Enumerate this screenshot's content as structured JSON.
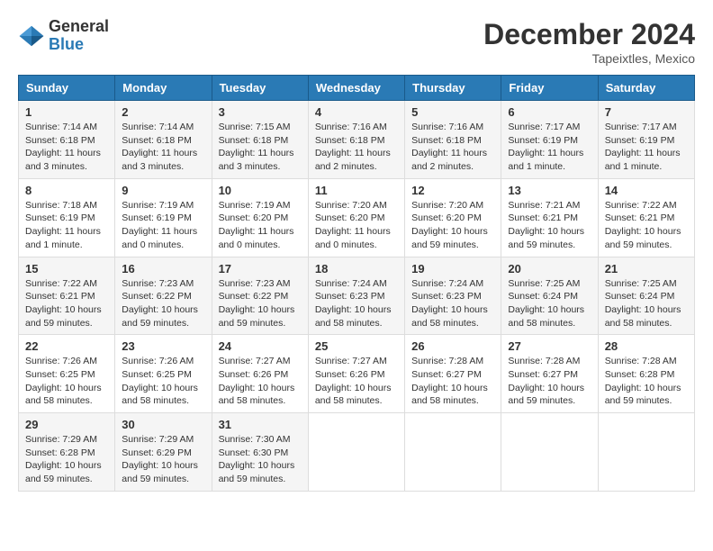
{
  "header": {
    "logo": {
      "general": "General",
      "blue": "Blue"
    },
    "title": "December 2024",
    "location": "Tapeixtles, Mexico"
  },
  "calendar": {
    "days_of_week": [
      "Sunday",
      "Monday",
      "Tuesday",
      "Wednesday",
      "Thursday",
      "Friday",
      "Saturday"
    ],
    "weeks": [
      [
        null,
        null,
        null,
        null,
        null,
        null,
        {
          "day": "1",
          "sunrise": "7:14 AM",
          "sunset": "6:18 PM",
          "daylight": "11 hours and 3 minutes."
        }
      ],
      [
        {
          "day": "1",
          "sunrise": "7:14 AM",
          "sunset": "6:18 PM",
          "daylight": "11 hours and 3 minutes."
        },
        {
          "day": "2",
          "sunrise": "7:14 AM",
          "sunset": "6:18 PM",
          "daylight": "11 hours and 3 minutes."
        },
        {
          "day": "3",
          "sunrise": "7:15 AM",
          "sunset": "6:18 PM",
          "daylight": "11 hours and 3 minutes."
        },
        {
          "day": "4",
          "sunrise": "7:16 AM",
          "sunset": "6:18 PM",
          "daylight": "11 hours and 2 minutes."
        },
        {
          "day": "5",
          "sunrise": "7:16 AM",
          "sunset": "6:18 PM",
          "daylight": "11 hours and 2 minutes."
        },
        {
          "day": "6",
          "sunrise": "7:17 AM",
          "sunset": "6:19 PM",
          "daylight": "11 hours and 1 minute."
        },
        {
          "day": "7",
          "sunrise": "7:17 AM",
          "sunset": "6:19 PM",
          "daylight": "11 hours and 1 minute."
        }
      ],
      [
        {
          "day": "8",
          "sunrise": "7:18 AM",
          "sunset": "6:19 PM",
          "daylight": "11 hours and 1 minute."
        },
        {
          "day": "9",
          "sunrise": "7:19 AM",
          "sunset": "6:19 PM",
          "daylight": "11 hours and 0 minutes."
        },
        {
          "day": "10",
          "sunrise": "7:19 AM",
          "sunset": "6:20 PM",
          "daylight": "11 hours and 0 minutes."
        },
        {
          "day": "11",
          "sunrise": "7:20 AM",
          "sunset": "6:20 PM",
          "daylight": "11 hours and 0 minutes."
        },
        {
          "day": "12",
          "sunrise": "7:20 AM",
          "sunset": "6:20 PM",
          "daylight": "10 hours and 59 minutes."
        },
        {
          "day": "13",
          "sunrise": "7:21 AM",
          "sunset": "6:21 PM",
          "daylight": "10 hours and 59 minutes."
        },
        {
          "day": "14",
          "sunrise": "7:22 AM",
          "sunset": "6:21 PM",
          "daylight": "10 hours and 59 minutes."
        }
      ],
      [
        {
          "day": "15",
          "sunrise": "7:22 AM",
          "sunset": "6:21 PM",
          "daylight": "10 hours and 59 minutes."
        },
        {
          "day": "16",
          "sunrise": "7:23 AM",
          "sunset": "6:22 PM",
          "daylight": "10 hours and 59 minutes."
        },
        {
          "day": "17",
          "sunrise": "7:23 AM",
          "sunset": "6:22 PM",
          "daylight": "10 hours and 59 minutes."
        },
        {
          "day": "18",
          "sunrise": "7:24 AM",
          "sunset": "6:23 PM",
          "daylight": "10 hours and 58 minutes."
        },
        {
          "day": "19",
          "sunrise": "7:24 AM",
          "sunset": "6:23 PM",
          "daylight": "10 hours and 58 minutes."
        },
        {
          "day": "20",
          "sunrise": "7:25 AM",
          "sunset": "6:24 PM",
          "daylight": "10 hours and 58 minutes."
        },
        {
          "day": "21",
          "sunrise": "7:25 AM",
          "sunset": "6:24 PM",
          "daylight": "10 hours and 58 minutes."
        }
      ],
      [
        {
          "day": "22",
          "sunrise": "7:26 AM",
          "sunset": "6:25 PM",
          "daylight": "10 hours and 58 minutes."
        },
        {
          "day": "23",
          "sunrise": "7:26 AM",
          "sunset": "6:25 PM",
          "daylight": "10 hours and 58 minutes."
        },
        {
          "day": "24",
          "sunrise": "7:27 AM",
          "sunset": "6:26 PM",
          "daylight": "10 hours and 58 minutes."
        },
        {
          "day": "25",
          "sunrise": "7:27 AM",
          "sunset": "6:26 PM",
          "daylight": "10 hours and 58 minutes."
        },
        {
          "day": "26",
          "sunrise": "7:28 AM",
          "sunset": "6:27 PM",
          "daylight": "10 hours and 58 minutes."
        },
        {
          "day": "27",
          "sunrise": "7:28 AM",
          "sunset": "6:27 PM",
          "daylight": "10 hours and 59 minutes."
        },
        {
          "day": "28",
          "sunrise": "7:28 AM",
          "sunset": "6:28 PM",
          "daylight": "10 hours and 59 minutes."
        }
      ],
      [
        {
          "day": "29",
          "sunrise": "7:29 AM",
          "sunset": "6:28 PM",
          "daylight": "10 hours and 59 minutes."
        },
        {
          "day": "30",
          "sunrise": "7:29 AM",
          "sunset": "6:29 PM",
          "daylight": "10 hours and 59 minutes."
        },
        {
          "day": "31",
          "sunrise": "7:30 AM",
          "sunset": "6:30 PM",
          "daylight": "10 hours and 59 minutes."
        },
        null,
        null,
        null,
        null
      ]
    ],
    "labels": {
      "sunrise": "Sunrise:",
      "sunset": "Sunset:",
      "daylight": "Daylight:"
    }
  }
}
